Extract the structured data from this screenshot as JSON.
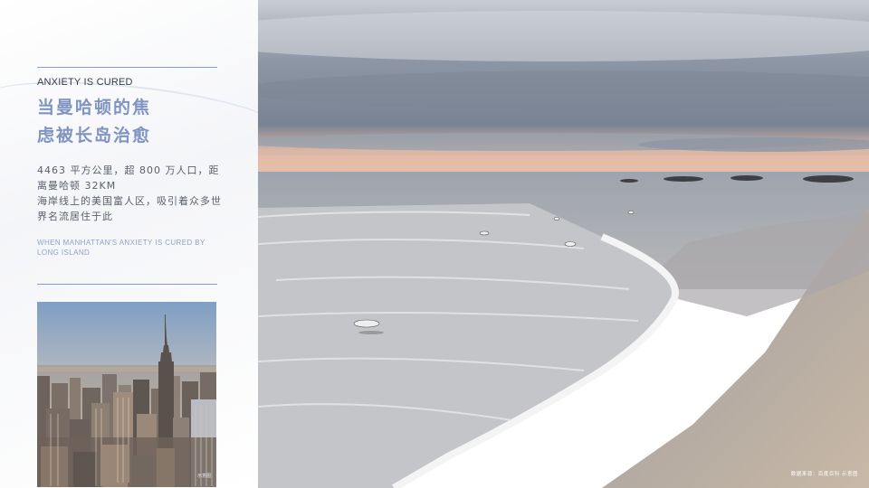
{
  "left": {
    "kicker": "ANXIETY IS CURED",
    "title_line1": "当曼哈顿的焦",
    "title_line2": "虑被长岛治愈",
    "body_line1": "4463 平方公里，超 800 万人口，距离曼哈顿 32KM",
    "body_line2": "海岸线上的美国富人区，吸引着众多世界名流居住于此",
    "english_note": "WHEN MANHATTAN'S ANXIETY IS CURED BY LONG ISLAND"
  },
  "photos": {
    "city_alt": "Manhattan skyline",
    "city_caption": "示意图",
    "beach_alt": "Long Island beach",
    "beach_caption": "数据来源：百度百科  示意图"
  },
  "colors": {
    "accent": "#7f94c2",
    "rule": "#8a9cc0",
    "text_dark": "#333a48",
    "text_body": "#5a5f6a"
  }
}
